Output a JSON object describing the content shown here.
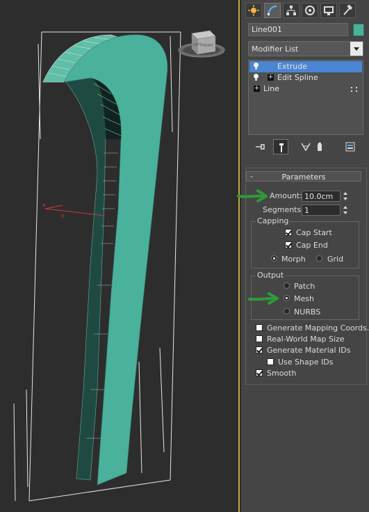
{
  "object": {
    "name": "Line001",
    "color": "#4ab19a"
  },
  "modifier_list": {
    "label": "Modifier List"
  },
  "stack": {
    "items": [
      {
        "label": "Extrude",
        "selected": true
      },
      {
        "label": "Edit Spline",
        "selected": false
      },
      {
        "label": "Line",
        "selected": false
      }
    ]
  },
  "parameters": {
    "title": "Parameters",
    "amount_label": "Amount:",
    "amount_value": "10.0cm",
    "segments_label": "Segments:",
    "segments_value": "1",
    "capping": {
      "title": "Capping",
      "cap_start": "Cap Start",
      "cap_end": "Cap End",
      "morph": "Morph",
      "grid": "Grid"
    },
    "output": {
      "title": "Output",
      "patch": "Patch",
      "mesh": "Mesh",
      "nurbs": "NURBS"
    },
    "gen_mapping": "Generate Mapping Coords.",
    "real_world": "Real-World Map Size",
    "gen_material": "Generate Material IDs",
    "use_shape": "Use Shape IDs",
    "smooth": "Smooth"
  },
  "viewport": {
    "axis_x": "x",
    "axis_y": "y",
    "viewcube_left": "LEFT",
    "viewcube_front": "FRONT"
  }
}
